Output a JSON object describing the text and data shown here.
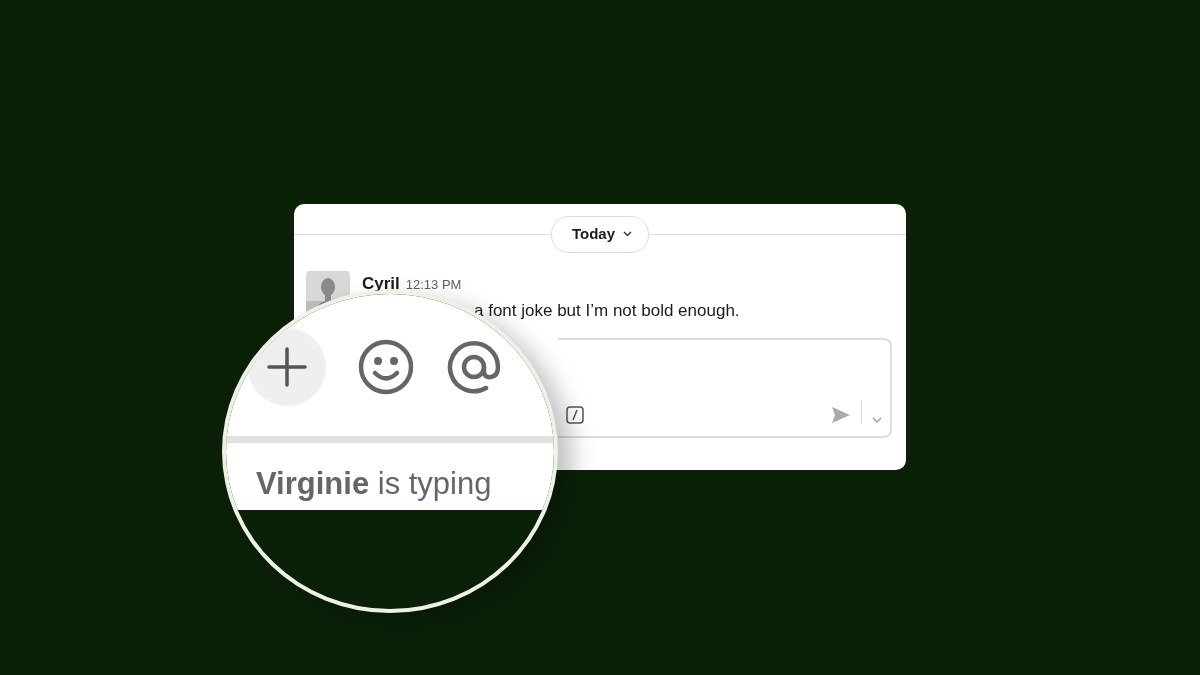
{
  "date_divider": {
    "label": "Today"
  },
  "message": {
    "author": "Cyril",
    "time": "12:13 PM",
    "text": "a font joke but I’m not bold enough."
  },
  "magnifier": {
    "typing_indicator": "**Virginie** is typing"
  }
}
